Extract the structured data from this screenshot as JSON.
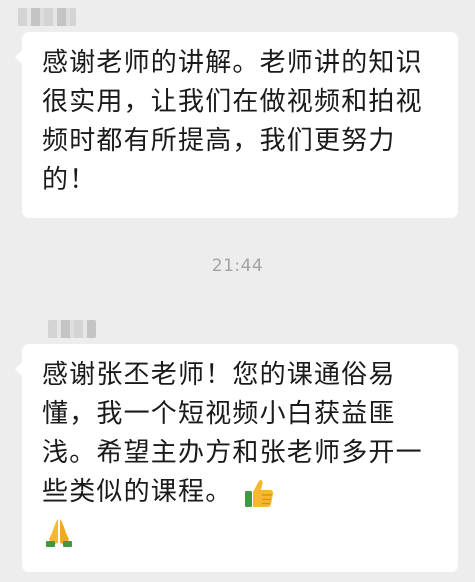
{
  "messages": [
    {
      "text": "感谢老师的讲解。老师讲的知识很实用，让我们在做视频和拍视频时都有所提高，我们更努力的！",
      "reactions": []
    },
    {
      "text": "感谢张丕老师！您的课通俗易懂，我一个短视频小白获益匪浅。希望主办方和张老师多开一些类似的课程。",
      "reactions": [
        "thumbs-up",
        "folded-hands"
      ]
    }
  ],
  "timestamp": "21:44"
}
